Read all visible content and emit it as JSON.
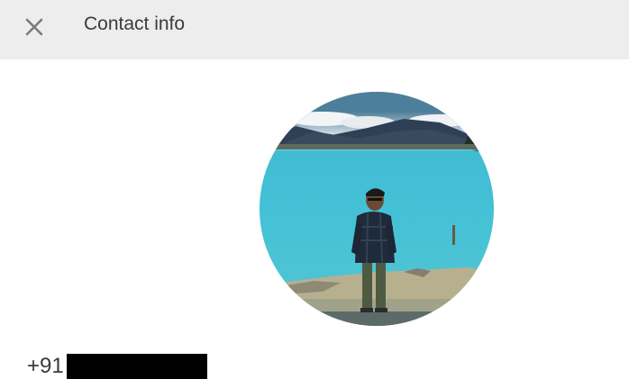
{
  "header": {
    "title": "Contact info",
    "close_icon": "close-icon"
  },
  "profile": {
    "photo_description_icon": "profile-photo"
  },
  "contact": {
    "phone_prefix": "+91"
  },
  "colors": {
    "header_bg": "#ededed",
    "text": "#3b3b3b",
    "redaction": "#000000"
  }
}
